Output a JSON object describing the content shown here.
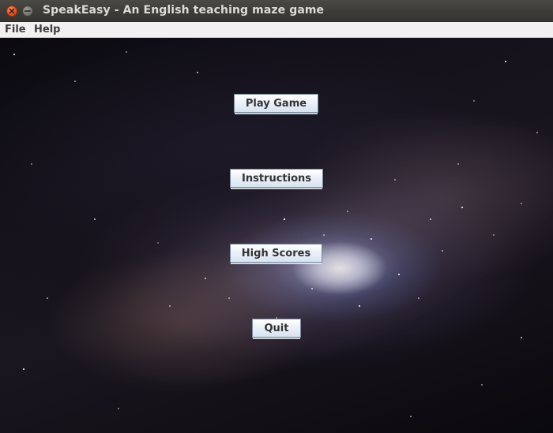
{
  "window": {
    "title": "SpeakEasy - An English teaching maze game",
    "controls": {
      "close_icon": "close-icon",
      "minimize_icon": "minimize-icon"
    }
  },
  "menubar": {
    "items": [
      {
        "label": "File"
      },
      {
        "label": "Help"
      }
    ]
  },
  "main_menu": {
    "background": "galaxy-image",
    "buttons": [
      {
        "label": "Play Game"
      },
      {
        "label": "Instructions"
      },
      {
        "label": "High Scores"
      },
      {
        "label": "Quit"
      }
    ]
  },
  "colors": {
    "titlebar": "#3c3b37",
    "close_button": "#e9541f",
    "menubar": "#f2f1f0",
    "button_top": "#ffffff",
    "button_bottom": "#d8e3f1",
    "button_border": "#7a8aa0"
  }
}
